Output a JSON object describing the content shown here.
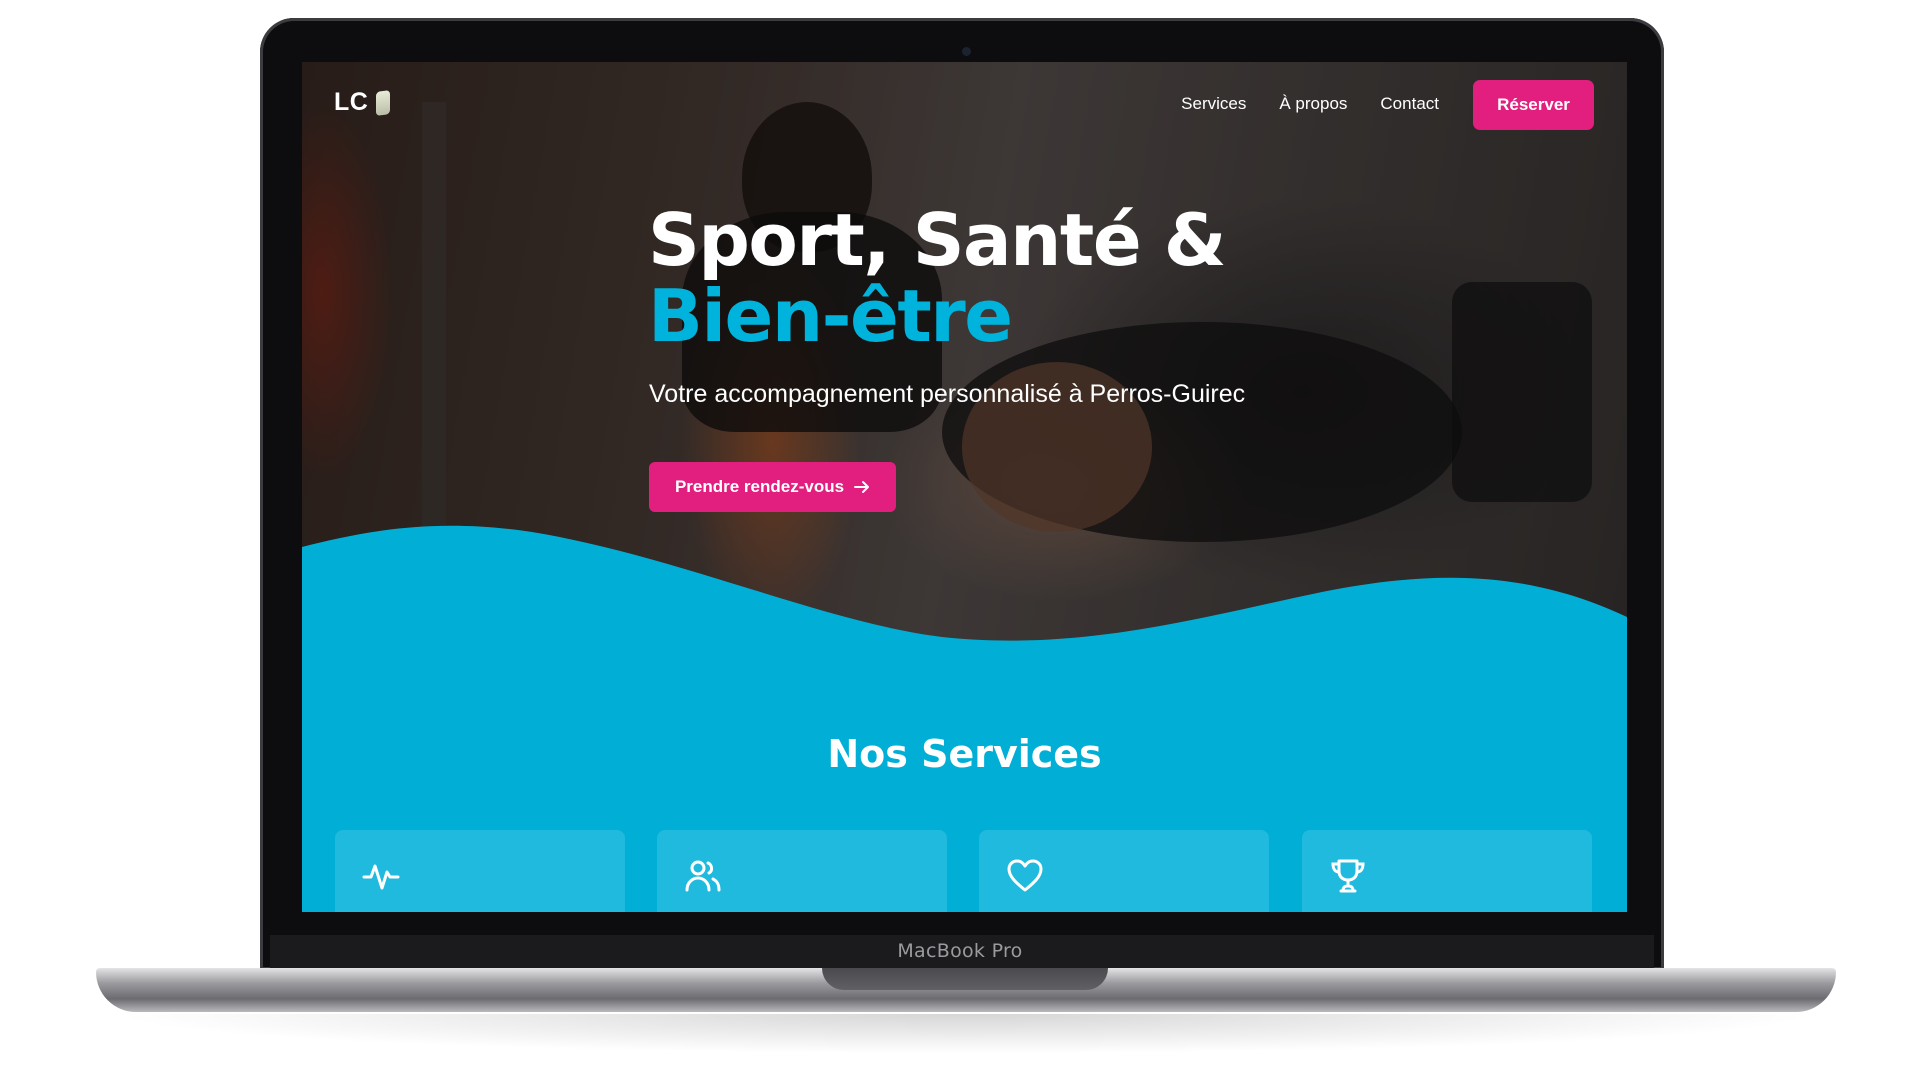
{
  "device": {
    "label": "MacBook Pro"
  },
  "site": {
    "logo_text": "LC",
    "nav": {
      "links": [
        "Services",
        "À propos",
        "Contact"
      ],
      "cta_label": "Réserver"
    },
    "hero": {
      "title_line1": "Sport, Santé &",
      "title_line2": "Bien-être",
      "subtitle": "Votre accompagnement personnalisé à Perros-Guirec",
      "cta_label": "Prendre rendez-vous",
      "cta_icon": "arrow-right-icon"
    },
    "services": {
      "title": "Nos Services",
      "cards": [
        {
          "icon": "activity-icon"
        },
        {
          "icon": "users-icon"
        },
        {
          "icon": "heart-icon"
        },
        {
          "icon": "trophy-icon"
        }
      ]
    }
  },
  "colors": {
    "accent_pink": "#e21f7e",
    "brand_cyan": "#01afd6",
    "card_cyan": "#1fbadd",
    "title_cyan": "#00b3dc"
  }
}
